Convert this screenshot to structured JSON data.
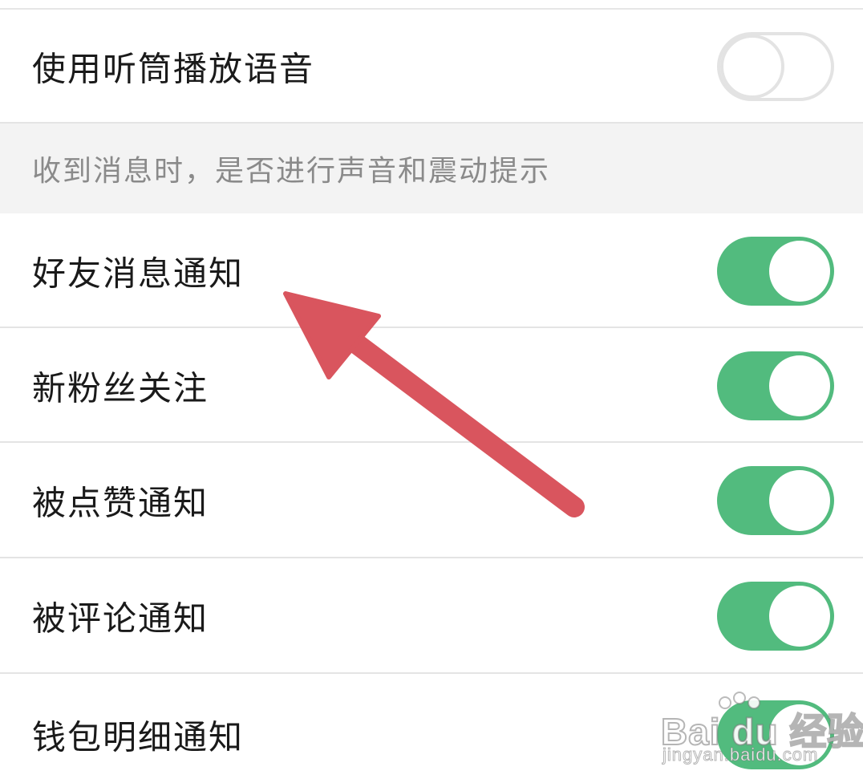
{
  "settings": {
    "earpiece_row": {
      "label": "使用听筒播放语音",
      "enabled": false
    },
    "notification_section": {
      "header": "收到消息时，是否进行声音和震动提示"
    },
    "items": [
      {
        "label": "好友消息通知",
        "enabled": true
      },
      {
        "label": "新粉丝关注",
        "enabled": true
      },
      {
        "label": "被点赞通知",
        "enabled": true
      },
      {
        "label": "被评论通知",
        "enabled": true
      },
      {
        "label": "钱包明细通知",
        "enabled": true
      }
    ]
  },
  "annotation": {
    "arrow_color": "#d9555e"
  },
  "colors": {
    "toggle_on": "#52bb7e",
    "toggle_off_border": "#e3e3e3",
    "section_bg": "#f3f3f3",
    "section_text": "#8a8a8a"
  },
  "watermark": {
    "logo": "Bai du 经验",
    "url": "jingyan.baidu.com"
  }
}
